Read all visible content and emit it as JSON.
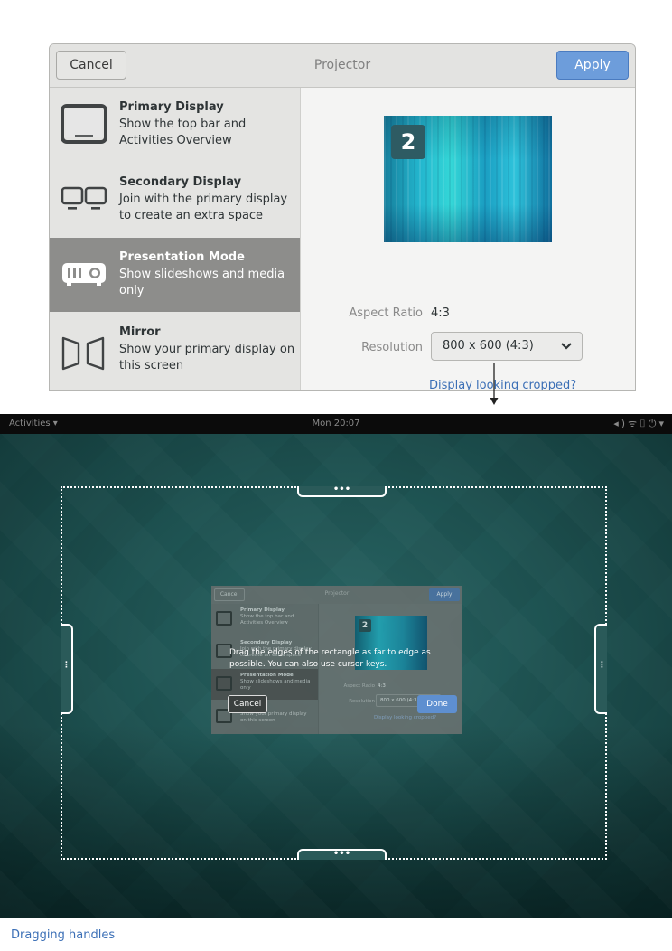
{
  "dialog": {
    "title": "Projector",
    "cancel_label": "Cancel",
    "apply_label": "Apply",
    "modes": [
      {
        "name": "Primary Display",
        "description": "Show the top bar and Activities Overview",
        "icon": "monitor-icon",
        "selected": false
      },
      {
        "name": "Secondary Display",
        "description": "Join with the primary display to create an extra space",
        "icon": "dual-monitor-icon",
        "selected": false
      },
      {
        "name": "Presentation Mode",
        "description": "Show slideshows and media only",
        "icon": "projector-icon",
        "selected": true
      },
      {
        "name": "Mirror",
        "description": "Show your primary display on this screen",
        "icon": "mirror-icon",
        "selected": false
      }
    ],
    "preview_number": "2",
    "aspect_ratio_label": "Aspect Ratio",
    "aspect_ratio_value": "4:3",
    "resolution_label": "Resolution",
    "resolution_value": "800 x 600 (4:3)",
    "cropped_link": "Display looking cropped?",
    "accent_color": "#6d9ddb",
    "selected_row_color": "#8d8d8b"
  },
  "desktop": {
    "topbar": {
      "activities": "Activities ▾",
      "clock": "Mon 20:07",
      "system_icons": [
        "volume-icon",
        "network-icon",
        "lock-icon",
        "power-icon"
      ]
    },
    "handles": {
      "top": "•••",
      "bottom": "•••",
      "left": "⋮",
      "right": "⋮"
    },
    "instructions": "Drag the edges of the  rectangle as far to edge as possible. You can also use cursor keys.",
    "cancel_label": "Cancel",
    "done_label": "Done",
    "background_color": "#173d3d"
  },
  "caption": "Dragging handles"
}
